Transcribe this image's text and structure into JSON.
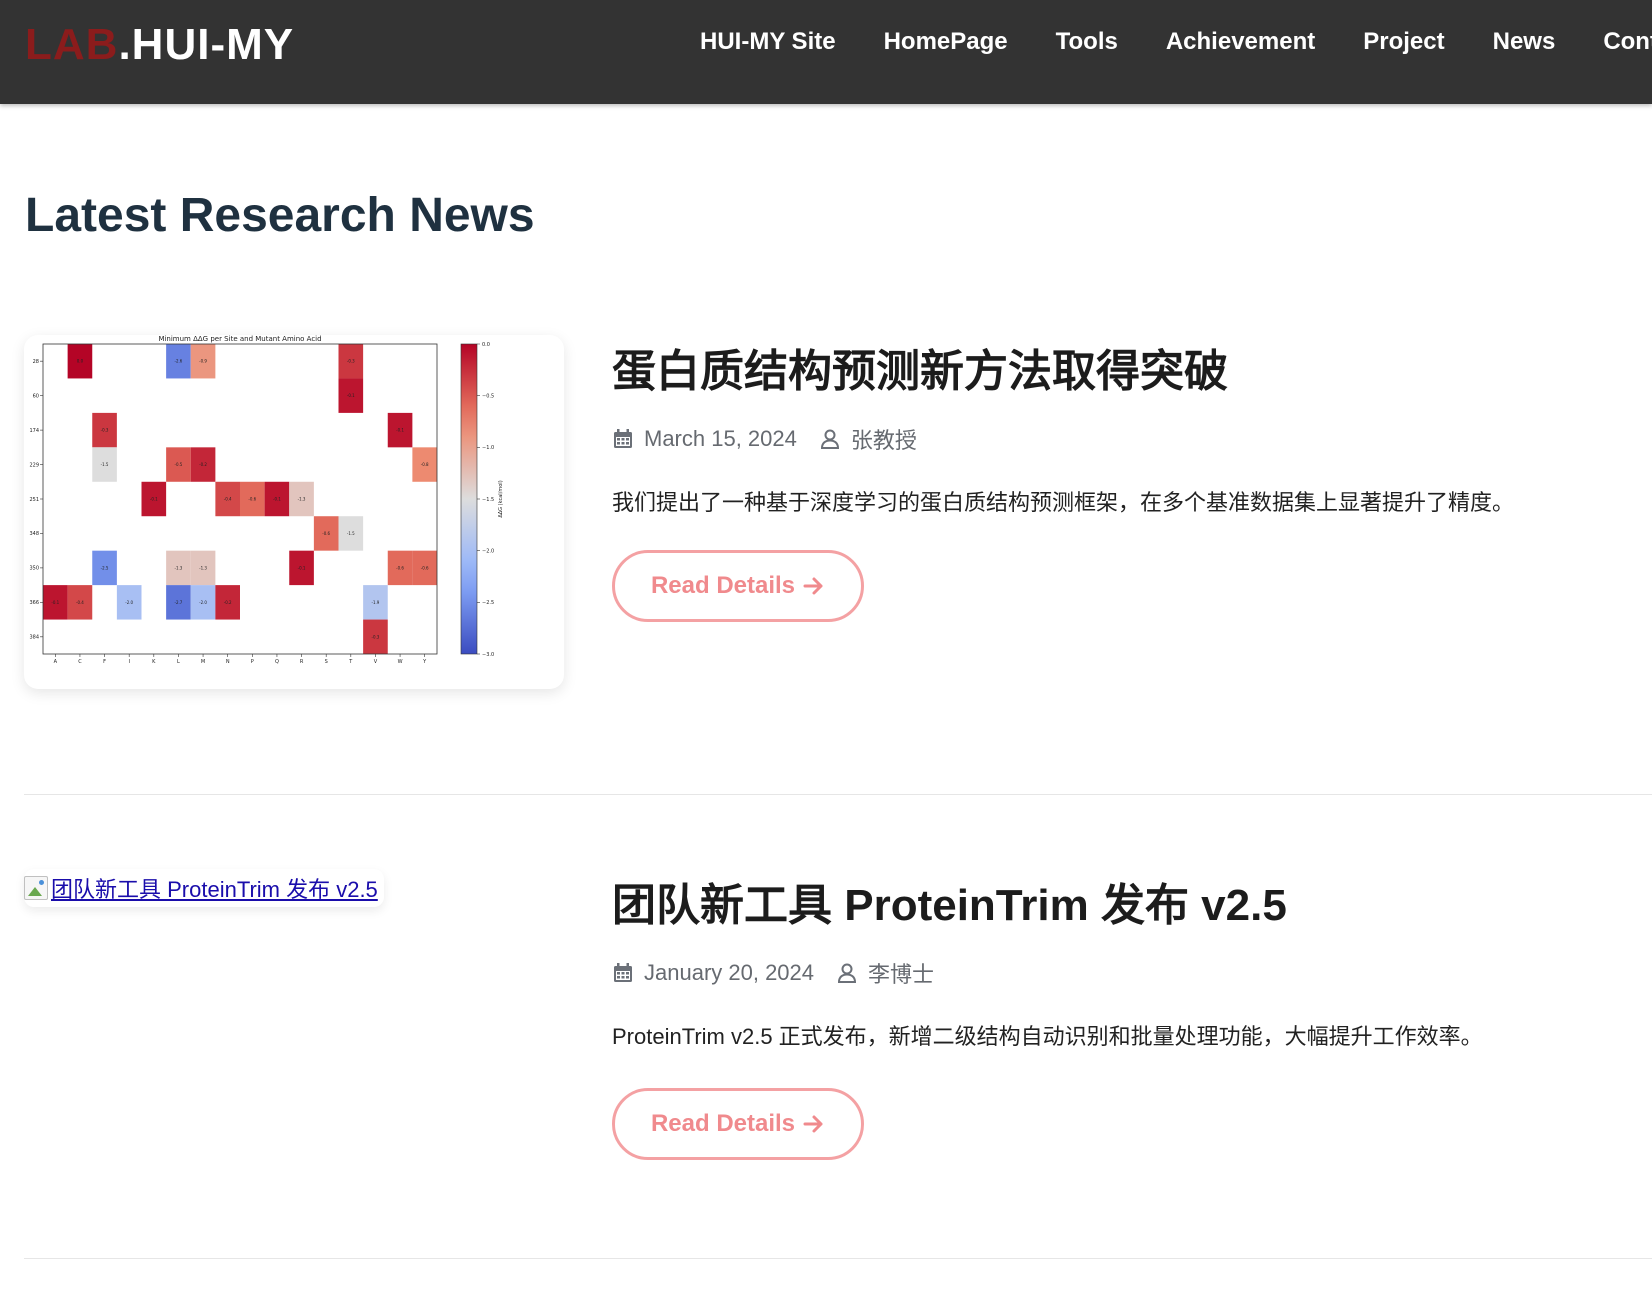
{
  "navbar": {
    "brand_accent": "LAB",
    "brand_main": ".HUI-MY",
    "links": [
      "HUI-MY Site",
      "HomePage",
      "Tools",
      "Achievement",
      "Project",
      "News",
      "Contac"
    ]
  },
  "page_title": "Latest Research News",
  "articles": [
    {
      "title": "蛋白质结构预测新方法取得突破",
      "date": "March 15, 2024",
      "author": "张教授",
      "excerpt": "我们提出了一种基于深度学习的蛋白质结构预测框架，在多个基准数据集上显著提升了精度。",
      "button_label": "Read Details",
      "image_alt": ""
    },
    {
      "title": "团队新工具 ProteinTrim 发布 v2.5",
      "date": "January 20, 2024",
      "author": "李博士",
      "excerpt": "ProteinTrim v2.5 正式发布，新增二级结构自动识别和批量处理功能，大幅提升工作效率。",
      "button_label": "Read Details",
      "image_alt": "团队新工具 ProteinTrim 发布 v2.5"
    }
  ],
  "icons": {
    "calendar": "calendar-icon",
    "user": "user-icon",
    "arrow": "arrow-right-icon",
    "broken_image": "broken-image-icon"
  },
  "colors": {
    "navbar_bg": "#333333",
    "brand_accent": "#8b1c1c",
    "title": "#1f3140",
    "button": "#f08a8d",
    "button_border": "#f4a1a3"
  },
  "chart_data": {
    "type": "heatmap",
    "title": "Minimum ΔΔG per Site and Mutant Amino Acid",
    "xlabel": "",
    "ylabel": "",
    "colorbar_label": "ΔΔG (kcal/mol)",
    "x_categories": [
      "A",
      "C",
      "F",
      "I",
      "K",
      "L",
      "M",
      "N",
      "P",
      "Q",
      "R",
      "S",
      "T",
      "V",
      "W",
      "Y"
    ],
    "y_categories": [
      "28",
      "60",
      "174",
      "229",
      "251",
      "348",
      "350",
      "366",
      "384"
    ],
    "vmin": -3.0,
    "vmax": 0.0,
    "colorbar_ticks": [
      "0.0",
      "−0.5",
      "−1.0",
      "−1.5",
      "−2.0",
      "−2.5",
      "−3.0"
    ],
    "colormap": "coolwarm_r",
    "cells": [
      {
        "y": "28",
        "x": "C",
        "value": -0.0
      },
      {
        "y": "28",
        "x": "L",
        "value": -2.6
      },
      {
        "y": "28",
        "x": "M",
        "value": -0.9
      },
      {
        "y": "28",
        "x": "T",
        "value": -0.3
      },
      {
        "y": "60",
        "x": "T",
        "value": -0.1
      },
      {
        "y": "174",
        "x": "F",
        "value": -0.3
      },
      {
        "y": "174",
        "x": "W",
        "value": -0.1
      },
      {
        "y": "229",
        "x": "F",
        "value": -1.5
      },
      {
        "y": "229",
        "x": "L",
        "value": -0.5
      },
      {
        "y": "229",
        "x": "M",
        "value": -0.2
      },
      {
        "y": "229",
        "x": "Y",
        "value": -0.8
      },
      {
        "y": "251",
        "x": "K",
        "value": -0.1
      },
      {
        "y": "251",
        "x": "N",
        "value": -0.4
      },
      {
        "y": "251",
        "x": "P",
        "value": -0.6
      },
      {
        "y": "251",
        "x": "Q",
        "value": -0.1
      },
      {
        "y": "251",
        "x": "R",
        "value": -1.3
      },
      {
        "y": "348",
        "x": "S",
        "value": -0.6
      },
      {
        "y": "348",
        "x": "T",
        "value": -1.5
      },
      {
        "y": "350",
        "x": "F",
        "value": -2.5
      },
      {
        "y": "350",
        "x": "L",
        "value": -1.3
      },
      {
        "y": "350",
        "x": "M",
        "value": -1.3
      },
      {
        "y": "350",
        "x": "R",
        "value": -0.1
      },
      {
        "y": "350",
        "x": "W",
        "value": -0.6
      },
      {
        "y": "350",
        "x": "Y",
        "value": -0.6
      },
      {
        "y": "366",
        "x": "A",
        "value": -0.1
      },
      {
        "y": "366",
        "x": "C",
        "value": -0.4
      },
      {
        "y": "366",
        "x": "I",
        "value": -2.0
      },
      {
        "y": "366",
        "x": "L",
        "value": -2.7
      },
      {
        "y": "366",
        "x": "M",
        "value": -2.0
      },
      {
        "y": "366",
        "x": "N",
        "value": -0.2
      },
      {
        "y": "366",
        "x": "V",
        "value": -1.9
      },
      {
        "y": "384",
        "x": "V",
        "value": -0.3
      }
    ]
  }
}
